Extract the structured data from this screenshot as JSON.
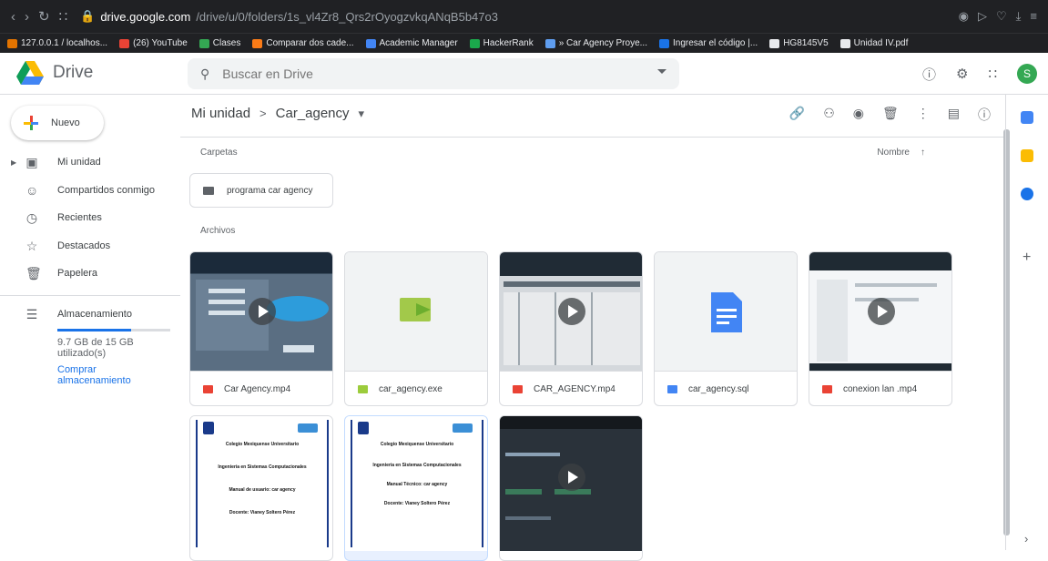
{
  "browser": {
    "url_host": "drive.google.com",
    "url_path": "/drive/u/0/folders/1s_vl4Zr8_Qrs2rOyogzvkqANqB5b47o3",
    "bookmarks": [
      {
        "label": "127.0.0.1 / localhos...",
        "color": "#e37400"
      },
      {
        "label": "(26) YouTube",
        "color": "#ea4335"
      },
      {
        "label": "Clases",
        "color": "#34a853"
      },
      {
        "label": "Comparar dos cade...",
        "color": "#fa7b17"
      },
      {
        "label": "Academic Manager",
        "color": "#4285f4"
      },
      {
        "label": "HackerRank",
        "color": "#1ba94c"
      },
      {
        "label": "» Car Agency Proye...",
        "color": "#5f9ef0"
      },
      {
        "label": "Ingresar el código |...",
        "color": "#1a73e8"
      },
      {
        "label": "HG8145V5",
        "color": "#e8eaed"
      },
      {
        "label": "Unidad IV.pdf",
        "color": "#e8eaed"
      }
    ]
  },
  "app": {
    "name": "Drive",
    "search_placeholder": "Buscar en Drive",
    "avatar_letter": "S"
  },
  "sidebar": {
    "new_label": "Nuevo",
    "items": [
      {
        "label": "Mi unidad",
        "icon": "drive-icon"
      },
      {
        "label": "Compartidos conmigo",
        "icon": "people-icon"
      },
      {
        "label": "Recientes",
        "icon": "clock-icon"
      },
      {
        "label": "Destacados",
        "icon": "star-icon"
      },
      {
        "label": "Papelera",
        "icon": "trash-icon"
      }
    ],
    "storage_label": "Almacenamiento",
    "storage_used": "9.7 GB de 15 GB utilizado(s)",
    "storage_fraction": 0.65,
    "buy_storage": "Comprar almacenamiento"
  },
  "main": {
    "crumb_root": "Mi unidad",
    "crumb_current": "Car_agency",
    "folders_label": "Carpetas",
    "sort_label": "Nombre",
    "folder_name": "programa car agency",
    "files_label": "Archivos",
    "files": [
      {
        "name": "Car Agency.mp4",
        "kind": "video",
        "color": "#ea4335"
      },
      {
        "name": "car_agency.exe",
        "kind": "exe",
        "color": "#9ccc3c"
      },
      {
        "name": "CAR_AGENCY.mp4",
        "kind": "video",
        "color": "#ea4335"
      },
      {
        "name": "car_agency.sql",
        "kind": "doc",
        "color": "#4285f4"
      },
      {
        "name": "conexion lan .mp4",
        "kind": "video",
        "color": "#ea4335"
      }
    ],
    "doc1": {
      "school": "Colegio Mexiquense Universitario",
      "career": "Ingeniería en Sistemas Computacionales",
      "title": "Manual de usuario: car agency",
      "teacher": "Docente: Vianey Soltero Pérez"
    },
    "doc2": {
      "school": "Colegio Mexiquense Universitario",
      "career": "Ingeniería en Sistemas Computacionales",
      "title": "Manual Técnico: car agency",
      "teacher": "Docente: Vianey Soltero Pérez"
    }
  }
}
